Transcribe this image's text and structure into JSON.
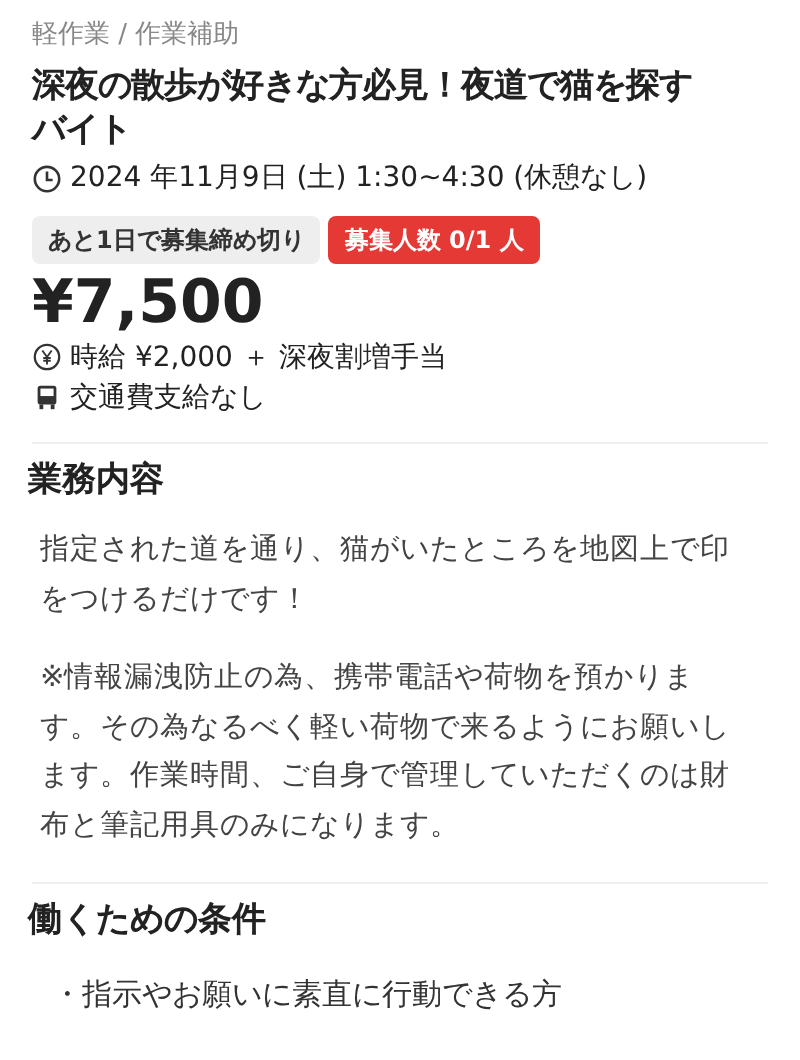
{
  "category": "軽作業 / 作業補助",
  "title": "深夜の散歩が好きな方必見！夜道で猫を探すバイト",
  "schedule": "2024 年11月9日 (土) 1:30~4:30 (休憩なし)",
  "badges": [
    {
      "kind": "deadline",
      "text": "あと1日で募集締め切り"
    },
    {
      "kind": "openings",
      "text": "募集人数 0/1 人"
    }
  ],
  "price": "¥7,500",
  "details": [
    {
      "kind": "wage",
      "text": "時給 ¥2,000 ＋ 深夜割増手当"
    },
    {
      "kind": "transport",
      "text": "交通費支給なし"
    }
  ],
  "sections": [
    {
      "heading": "業務内容",
      "paragraphs": [
        "指定された道を通り、猫がいたところを地図上で印をつけるだけです！",
        "※情報漏洩防止の為、携帯電話や荷物を預かります。その為なるべく軽い荷物で来るようにお願いします。作業時間、ご自身で管理していただくのは財布と筆記用具のみになります。"
      ]
    },
    {
      "heading": "働くための条件",
      "bullets": [
        "・指示やお願いに素直に行動できる方"
      ]
    }
  ]
}
